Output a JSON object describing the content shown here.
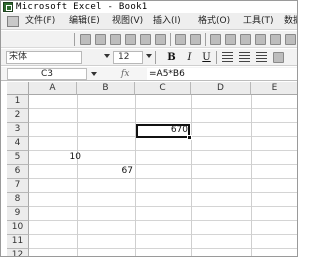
{
  "window": {
    "title": "Microsoft Excel - Book1"
  },
  "menu": {
    "items": [
      "文件(F)",
      "编辑(E)",
      "视图(V)",
      "插入(I)",
      "格式(O)",
      "工具(T)",
      "数据"
    ]
  },
  "format_bar": {
    "font_name": "宋体",
    "font_size": "12",
    "bold_label": "B",
    "italic_label": "I",
    "underline_label": "U"
  },
  "formula_bar": {
    "name_box": "C3",
    "fx_label": "fx",
    "formula": "=A5*B6"
  },
  "sheet": {
    "columns": [
      "A",
      "B",
      "C",
      "D",
      "E"
    ],
    "rows": [
      "1",
      "2",
      "3",
      "4",
      "5",
      "6",
      "7",
      "8",
      "9",
      "10",
      "11",
      "12"
    ],
    "cells": {
      "A5": "10",
      "B6": "67",
      "C3": "670"
    },
    "active_cell": "C3"
  }
}
